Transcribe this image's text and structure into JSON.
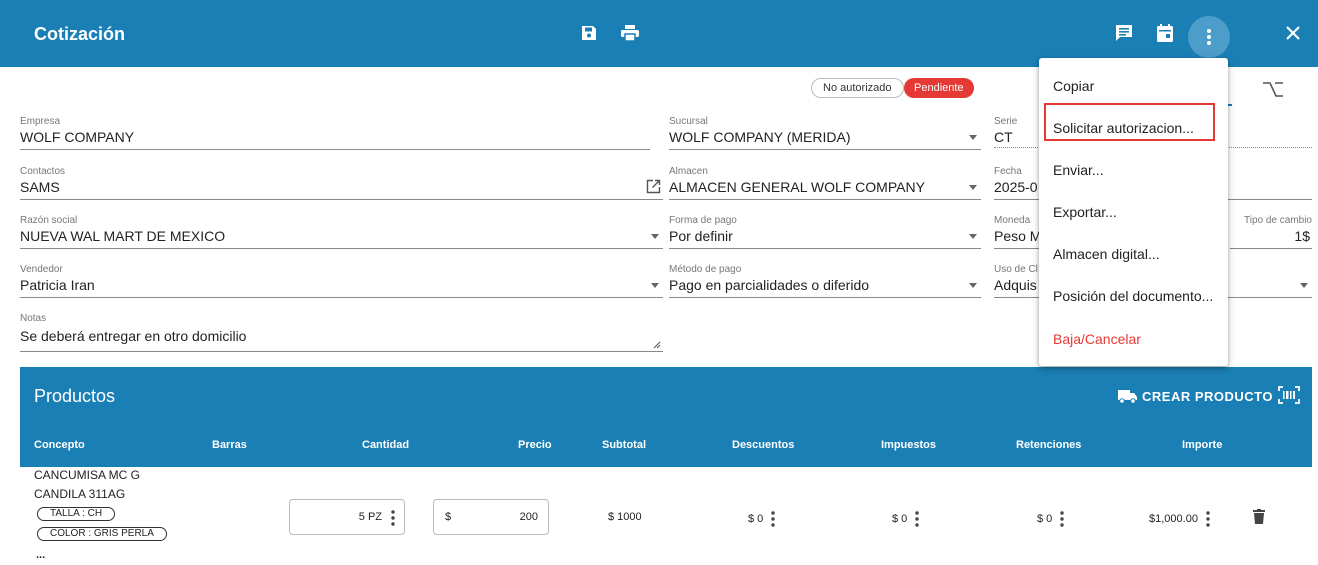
{
  "header": {
    "title": "Cotización",
    "colors": {
      "primary": "#1a7fb5",
      "danger": "#e53935"
    }
  },
  "status": {
    "not_authorized": "No autorizado",
    "pending": "Pendiente"
  },
  "fields": {
    "empresa": {
      "label": "Empresa",
      "value": "WOLF COMPANY"
    },
    "sucursal": {
      "label": "Sucursal",
      "value": "WOLF COMPANY (MERIDA)"
    },
    "serie": {
      "label": "Serie",
      "value": "CT"
    },
    "contactos": {
      "label": "Contactos",
      "value": "SAMS"
    },
    "almacen": {
      "label": "Almacen",
      "value": "ALMACEN GENERAL WOLF COMPANY"
    },
    "fecha": {
      "label": "Fecha",
      "value": "2025-0"
    },
    "razon_social": {
      "label": "Razón social",
      "value": "NUEVA WAL MART DE MEXICO"
    },
    "forma_pago": {
      "label": "Forma de pago",
      "value": "Por definir"
    },
    "moneda": {
      "label": "Moneda",
      "value": "Peso M"
    },
    "tipo_cambio": {
      "label": "Tipo de cambio",
      "value": "1$"
    },
    "vendedor": {
      "label": "Vendedor",
      "value": "Patricia Iran"
    },
    "metodo_pago": {
      "label": "Método de pago",
      "value": "Pago en parcialidades o diferido"
    },
    "uso_cfdi": {
      "label": "Uso de Cl",
      "value": "Adquis"
    },
    "notas": {
      "label": "Notas",
      "value": "Se deberá entregar en otro domicilio"
    }
  },
  "products": {
    "title": "Productos",
    "create_label": "CREAR PRODUCTO",
    "columns": [
      "Concepto",
      "Barras",
      "Cantidad",
      "Precio",
      "Subtotal",
      "Descuentos",
      "Impuestos",
      "Retenciones",
      "Importe"
    ],
    "row": {
      "concept_line1": "CANCUMISA MC G",
      "concept_line2": "CANDILA 311AG",
      "tags": [
        "TALLA : CH",
        "COLOR : GRIS PERLA"
      ],
      "more": "...",
      "quantity": "5 PZ",
      "currency_symbol": "$",
      "price": "200",
      "subtotal": "$ 1000",
      "discounts": "$ 0",
      "taxes": "$ 0",
      "retentions": "$ 0",
      "amount": "$1,000.00"
    }
  },
  "menu": {
    "items": [
      "Copiar",
      "Solicitar autorizacion...",
      "Enviar...",
      "Exportar...",
      "Almacen digital...",
      "Posición del documento...",
      "Baja/Cancelar"
    ]
  }
}
